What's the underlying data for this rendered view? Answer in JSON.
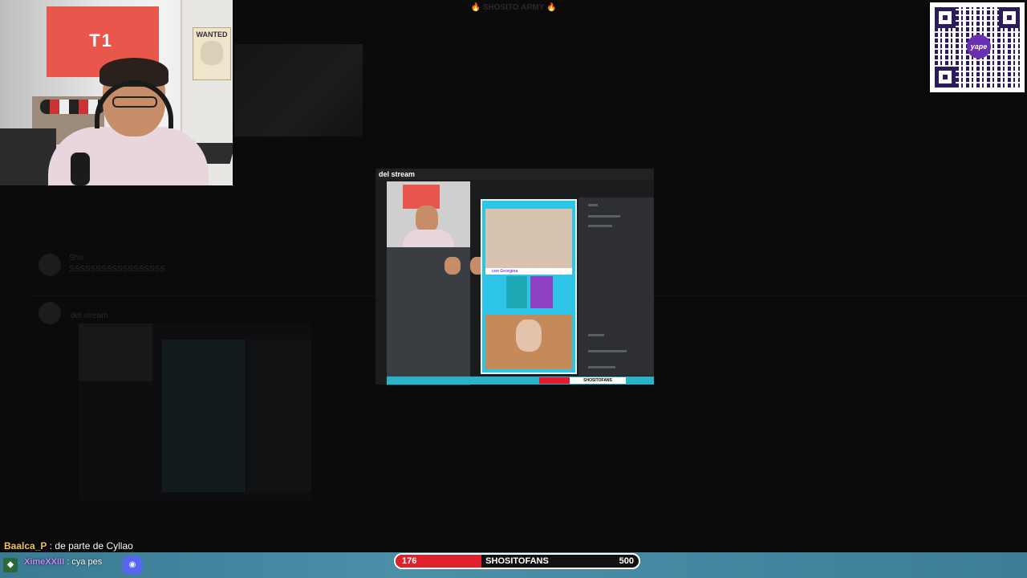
{
  "background": {
    "header_text": "🔥 SHOSITO ARMY 🔥",
    "messages": [
      {
        "name": "Sho",
        "text": "SSSSSSSSSSSSSSSSSS"
      },
      {
        "name": "",
        "text": "del stream"
      }
    ]
  },
  "shot": {
    "title": "del stream",
    "phone_banner": "con Georgina",
    "bar_label": "SHOSITOFANS"
  },
  "chat": {
    "user": "Baalca_P",
    "separator": " : ",
    "text": "de parte de Cyllao"
  },
  "bottom_chat": {
    "user": "XimeXXIII",
    "text": ": cya pes"
  },
  "goal": {
    "current": "176",
    "label": "SHOSITOFANS",
    "target": "500",
    "progress": 0.352,
    "color": "#e0212d"
  },
  "qr": {
    "logo": "yape"
  },
  "colors": {
    "bar": "#4b8fa8",
    "goal_red": "#e0212d",
    "discord": "#5865f2"
  }
}
